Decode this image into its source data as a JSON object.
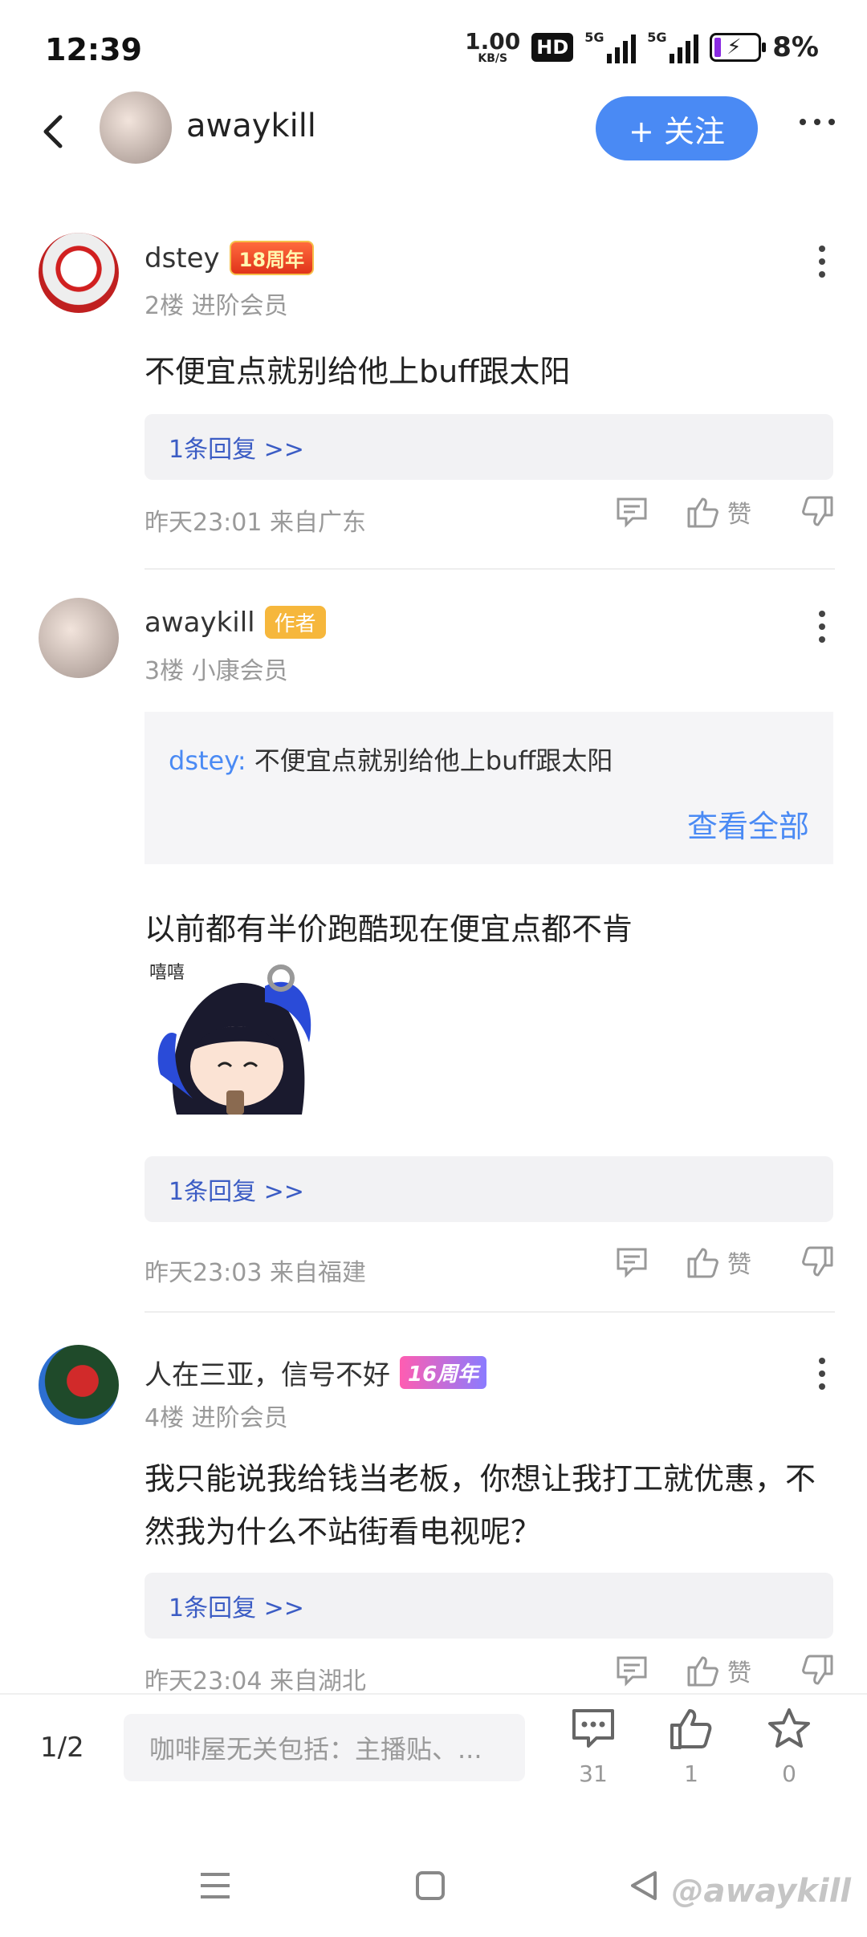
{
  "status_bar": {
    "time": "12:39",
    "net_speed": "1.00",
    "net_unit": "KB/S",
    "hd": "HD",
    "signal_1": "5G",
    "signal_2": "5G",
    "battery": "8%"
  },
  "header": {
    "username": "awaykill",
    "follow_label": "+ 关注"
  },
  "posts": [
    {
      "user": "dstey",
      "badge": "18周年",
      "meta": "2楼 进阶会员",
      "text": "不便宜点就别给他上buff跟太阳",
      "replies": "1条回复 >>",
      "time": "昨天23:01 来自广东",
      "like": "赞"
    },
    {
      "user": "awaykill",
      "badge": "作者",
      "meta": "3楼 小康会员",
      "quote_user": "dstey:",
      "quote_text": "不便宜点就别给他上buff跟太阳",
      "quote_more": "查看全部",
      "text": "以前都有半价跑酷现在便宜点都不肯",
      "sticker_text": "嘻嘻",
      "replies": "1条回复 >>",
      "time": "昨天23:03 来自福建",
      "like": "赞"
    },
    {
      "user": "人在三亚，信号不好",
      "badge": "16周年",
      "meta": "4楼 进阶会员",
      "text": "我只能说我给钱当老板，你想让我打工就优惠，不然我为什么不站街看电视呢？",
      "replies": "1条回复 >>",
      "time": "昨天23:04 来自湖北",
      "like": "赞"
    }
  ],
  "bottom_bar": {
    "page": "1/2",
    "input_placeholder": "咖啡屋无关包括：主播贴、...",
    "comments": "31",
    "likes": "1",
    "stars": "0"
  },
  "watermark": "@awaykill"
}
